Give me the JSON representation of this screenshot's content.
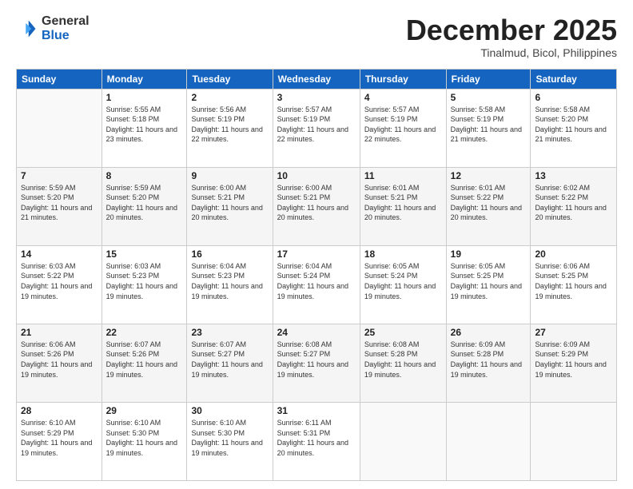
{
  "header": {
    "logo_general": "General",
    "logo_blue": "Blue",
    "month_title": "December 2025",
    "subtitle": "Tinalmud, Bicol, Philippines"
  },
  "weekdays": [
    "Sunday",
    "Monday",
    "Tuesday",
    "Wednesday",
    "Thursday",
    "Friday",
    "Saturday"
  ],
  "weeks": [
    [
      {
        "day": "",
        "sunrise": "",
        "sunset": "",
        "daylight": ""
      },
      {
        "day": "1",
        "sunrise": "Sunrise: 5:55 AM",
        "sunset": "Sunset: 5:18 PM",
        "daylight": "Daylight: 11 hours and 23 minutes."
      },
      {
        "day": "2",
        "sunrise": "Sunrise: 5:56 AM",
        "sunset": "Sunset: 5:19 PM",
        "daylight": "Daylight: 11 hours and 22 minutes."
      },
      {
        "day": "3",
        "sunrise": "Sunrise: 5:57 AM",
        "sunset": "Sunset: 5:19 PM",
        "daylight": "Daylight: 11 hours and 22 minutes."
      },
      {
        "day": "4",
        "sunrise": "Sunrise: 5:57 AM",
        "sunset": "Sunset: 5:19 PM",
        "daylight": "Daylight: 11 hours and 22 minutes."
      },
      {
        "day": "5",
        "sunrise": "Sunrise: 5:58 AM",
        "sunset": "Sunset: 5:19 PM",
        "daylight": "Daylight: 11 hours and 21 minutes."
      },
      {
        "day": "6",
        "sunrise": "Sunrise: 5:58 AM",
        "sunset": "Sunset: 5:20 PM",
        "daylight": "Daylight: 11 hours and 21 minutes."
      }
    ],
    [
      {
        "day": "7",
        "sunrise": "Sunrise: 5:59 AM",
        "sunset": "Sunset: 5:20 PM",
        "daylight": "Daylight: 11 hours and 21 minutes."
      },
      {
        "day": "8",
        "sunrise": "Sunrise: 5:59 AM",
        "sunset": "Sunset: 5:20 PM",
        "daylight": "Daylight: 11 hours and 20 minutes."
      },
      {
        "day": "9",
        "sunrise": "Sunrise: 6:00 AM",
        "sunset": "Sunset: 5:21 PM",
        "daylight": "Daylight: 11 hours and 20 minutes."
      },
      {
        "day": "10",
        "sunrise": "Sunrise: 6:00 AM",
        "sunset": "Sunset: 5:21 PM",
        "daylight": "Daylight: 11 hours and 20 minutes."
      },
      {
        "day": "11",
        "sunrise": "Sunrise: 6:01 AM",
        "sunset": "Sunset: 5:21 PM",
        "daylight": "Daylight: 11 hours and 20 minutes."
      },
      {
        "day": "12",
        "sunrise": "Sunrise: 6:01 AM",
        "sunset": "Sunset: 5:22 PM",
        "daylight": "Daylight: 11 hours and 20 minutes."
      },
      {
        "day": "13",
        "sunrise": "Sunrise: 6:02 AM",
        "sunset": "Sunset: 5:22 PM",
        "daylight": "Daylight: 11 hours and 20 minutes."
      }
    ],
    [
      {
        "day": "14",
        "sunrise": "Sunrise: 6:03 AM",
        "sunset": "Sunset: 5:22 PM",
        "daylight": "Daylight: 11 hours and 19 minutes."
      },
      {
        "day": "15",
        "sunrise": "Sunrise: 6:03 AM",
        "sunset": "Sunset: 5:23 PM",
        "daylight": "Daylight: 11 hours and 19 minutes."
      },
      {
        "day": "16",
        "sunrise": "Sunrise: 6:04 AM",
        "sunset": "Sunset: 5:23 PM",
        "daylight": "Daylight: 11 hours and 19 minutes."
      },
      {
        "day": "17",
        "sunrise": "Sunrise: 6:04 AM",
        "sunset": "Sunset: 5:24 PM",
        "daylight": "Daylight: 11 hours and 19 minutes."
      },
      {
        "day": "18",
        "sunrise": "Sunrise: 6:05 AM",
        "sunset": "Sunset: 5:24 PM",
        "daylight": "Daylight: 11 hours and 19 minutes."
      },
      {
        "day": "19",
        "sunrise": "Sunrise: 6:05 AM",
        "sunset": "Sunset: 5:25 PM",
        "daylight": "Daylight: 11 hours and 19 minutes."
      },
      {
        "day": "20",
        "sunrise": "Sunrise: 6:06 AM",
        "sunset": "Sunset: 5:25 PM",
        "daylight": "Daylight: 11 hours and 19 minutes."
      }
    ],
    [
      {
        "day": "21",
        "sunrise": "Sunrise: 6:06 AM",
        "sunset": "Sunset: 5:26 PM",
        "daylight": "Daylight: 11 hours and 19 minutes."
      },
      {
        "day": "22",
        "sunrise": "Sunrise: 6:07 AM",
        "sunset": "Sunset: 5:26 PM",
        "daylight": "Daylight: 11 hours and 19 minutes."
      },
      {
        "day": "23",
        "sunrise": "Sunrise: 6:07 AM",
        "sunset": "Sunset: 5:27 PM",
        "daylight": "Daylight: 11 hours and 19 minutes."
      },
      {
        "day": "24",
        "sunrise": "Sunrise: 6:08 AM",
        "sunset": "Sunset: 5:27 PM",
        "daylight": "Daylight: 11 hours and 19 minutes."
      },
      {
        "day": "25",
        "sunrise": "Sunrise: 6:08 AM",
        "sunset": "Sunset: 5:28 PM",
        "daylight": "Daylight: 11 hours and 19 minutes."
      },
      {
        "day": "26",
        "sunrise": "Sunrise: 6:09 AM",
        "sunset": "Sunset: 5:28 PM",
        "daylight": "Daylight: 11 hours and 19 minutes."
      },
      {
        "day": "27",
        "sunrise": "Sunrise: 6:09 AM",
        "sunset": "Sunset: 5:29 PM",
        "daylight": "Daylight: 11 hours and 19 minutes."
      }
    ],
    [
      {
        "day": "28",
        "sunrise": "Sunrise: 6:10 AM",
        "sunset": "Sunset: 5:29 PM",
        "daylight": "Daylight: 11 hours and 19 minutes."
      },
      {
        "day": "29",
        "sunrise": "Sunrise: 6:10 AM",
        "sunset": "Sunset: 5:30 PM",
        "daylight": "Daylight: 11 hours and 19 minutes."
      },
      {
        "day": "30",
        "sunrise": "Sunrise: 6:10 AM",
        "sunset": "Sunset: 5:30 PM",
        "daylight": "Daylight: 11 hours and 19 minutes."
      },
      {
        "day": "31",
        "sunrise": "Sunrise: 6:11 AM",
        "sunset": "Sunset: 5:31 PM",
        "daylight": "Daylight: 11 hours and 20 minutes."
      },
      {
        "day": "",
        "sunrise": "",
        "sunset": "",
        "daylight": ""
      },
      {
        "day": "",
        "sunrise": "",
        "sunset": "",
        "daylight": ""
      },
      {
        "day": "",
        "sunrise": "",
        "sunset": "",
        "daylight": ""
      }
    ]
  ]
}
